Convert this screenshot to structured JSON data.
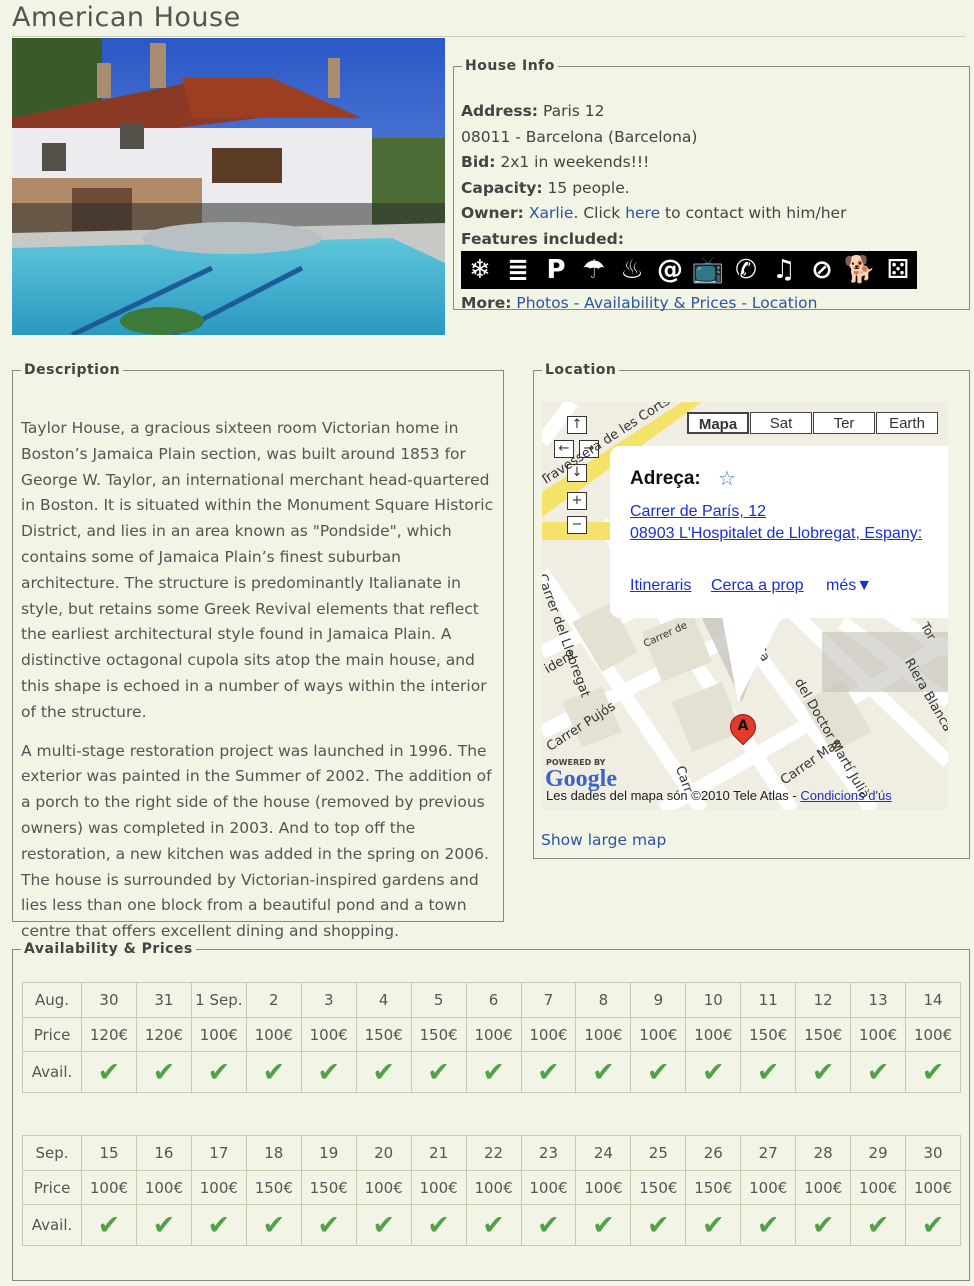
{
  "title": "American House",
  "house_info": {
    "legend": "House Info",
    "address_label": "Address:",
    "address": "Paris 12",
    "city": "08011 - Barcelona (Barcelona)",
    "bid_label": "Bid:",
    "bid": "2x1 in weekends!!!",
    "capacity_label": "Capacity:",
    "capacity": "15 people.",
    "owner_label": "Owner:",
    "owner": "Xarlie",
    "owner_text1": ". Click ",
    "owner_here": "here",
    "owner_text2": " to contact with him/her",
    "features_label": "Features included:",
    "features": [
      {
        "icon": "snowflake-icon",
        "glyph": "❄"
      },
      {
        "icon": "heating-icon",
        "glyph": "≣"
      },
      {
        "icon": "parking-icon",
        "glyph": "P"
      },
      {
        "icon": "terrace-icon",
        "glyph": "☂"
      },
      {
        "icon": "pool-icon",
        "glyph": "♨"
      },
      {
        "icon": "internet-icon",
        "glyph": "@"
      },
      {
        "icon": "tv-icon",
        "glyph": "📺"
      },
      {
        "icon": "phone-icon",
        "glyph": "✆"
      },
      {
        "icon": "music-icon",
        "glyph": "♫"
      },
      {
        "icon": "no-smoking-icon",
        "glyph": "⊘"
      },
      {
        "icon": "pets-icon",
        "glyph": "🐕"
      },
      {
        "icon": "games-icon",
        "glyph": "⚄"
      }
    ],
    "more_label": "More:",
    "more_links": [
      "Photos",
      "Availability & Prices",
      "Location"
    ],
    "more_sep": " - "
  },
  "description": {
    "legend": "Description",
    "paragraphs": [
      "Taylor House, a gracious sixteen room Victorian home in Boston’s Jamaica Plain section, was built around 1853 for George W. Taylor, an international merchant head-quartered in Boston. It is situated within the Monument Square Historic District, and lies in an area known as \"Pondside\", which contains some of Jamaica Plain’s finest suburban architecture. The structure is predominantly Italianate in style, but retains some Greek Revival elements that reflect the earliest architectural style found in Jamaica Plain. A distinctive octagonal cupola sits atop the main house, and this shape is echoed in a number of ways within the interior of the structure.",
      "A multi-stage restoration project was launched in 1996. The exterior was painted in the Summer of 2002. The addition of a porch to the right side of the house (removed by previous owners) was completed in 2003. And to top off the restoration, a new kitchen was added in the spring on 2006. The house is surrounded by Victorian-inspired gardens and lies less than one block from a beautiful pond and a town centre that offers excellent dining and shopping."
    ]
  },
  "location": {
    "legend": "Location",
    "map_types": [
      "Mapa",
      "Sat",
      "Ter",
      "Earth"
    ],
    "popup_title": "Adreça:",
    "popup_address1": "Carrer de París, 12",
    "popup_address2": "08903 L'Hospitalet de Llobregat, Espany:",
    "popup_links": [
      "Itineraris",
      "Cerca a prop",
      "més▼"
    ],
    "streets": [
      "Travessera de les Corts",
      "Carrer del Llobregat",
      "Carrer de",
      "Carrer Pujós",
      "Carrer Mas",
      "del Doctor Martí Julià",
      "Riera Blanca",
      "Ca",
      "Carr",
      "ident",
      "Tor"
    ],
    "marker": "A",
    "powered_by": "POWERED BY",
    "google": "Google",
    "copyright": "Les dades del mapa són ©2010 Tele Atlas - ",
    "terms": "Condicions d'ús",
    "show_large": "Show large map"
  },
  "availability": {
    "legend": "Availability & Prices",
    "row_labels": {
      "price": "Price",
      "avail": "Avail."
    },
    "tables": [
      {
        "month": "Aug.",
        "days": [
          "30",
          "31",
          "1 Sep.",
          "2",
          "3",
          "4",
          "5",
          "6",
          "7",
          "8",
          "9",
          "10",
          "11",
          "12",
          "13",
          "14"
        ],
        "prices": [
          "120€",
          "120€",
          "100€",
          "100€",
          "100€",
          "150€",
          "150€",
          "100€",
          "100€",
          "100€",
          "100€",
          "100€",
          "150€",
          "150€",
          "100€",
          "100€"
        ],
        "available": [
          true,
          true,
          true,
          true,
          true,
          true,
          true,
          true,
          true,
          true,
          true,
          true,
          true,
          true,
          true,
          true
        ]
      },
      {
        "month": "Sep.",
        "days": [
          "15",
          "16",
          "17",
          "18",
          "19",
          "20",
          "21",
          "22",
          "23",
          "24",
          "25",
          "26",
          "27",
          "28",
          "29",
          "30"
        ],
        "prices": [
          "100€",
          "100€",
          "100€",
          "150€",
          "150€",
          "100€",
          "100€",
          "100€",
          "100€",
          "100€",
          "150€",
          "150€",
          "100€",
          "100€",
          "100€",
          "100€"
        ],
        "available": [
          true,
          true,
          true,
          true,
          true,
          true,
          true,
          true,
          true,
          true,
          true,
          true,
          true,
          true,
          true,
          true
        ]
      }
    ],
    "tick": "✔"
  }
}
